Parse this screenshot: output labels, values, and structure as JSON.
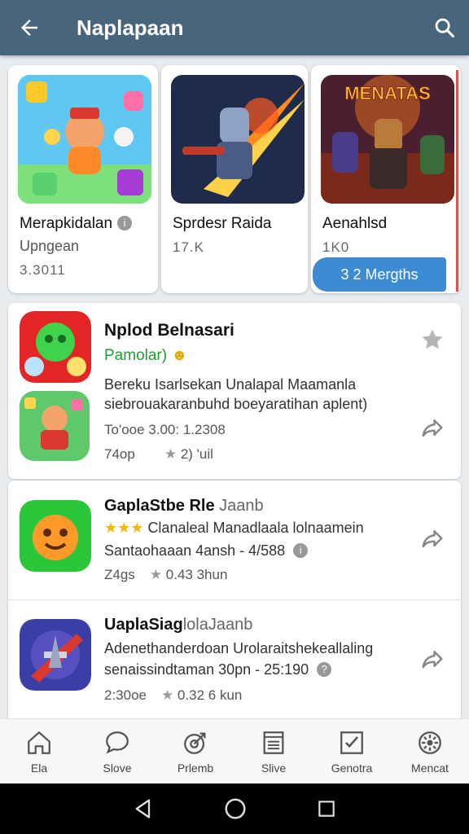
{
  "appbar": {
    "title": "Naplapaan"
  },
  "featured": [
    {
      "name": "Merapkidalan",
      "sub": "Upngean",
      "meta": "3.3011"
    },
    {
      "name": "Sprdesr Raida",
      "meta": "17.K"
    },
    {
      "name": "Aenahlsd",
      "meta": "1K0",
      "art_text": "MENATAS",
      "button": "3 2 Mergths"
    }
  ],
  "list": [
    {
      "title": "Nplod Belnasari",
      "tag": "Pamolar)",
      "desc1": "Bereku Isarlsekan Unalapal Maamanla",
      "desc2": "siebrouakaranbuhd boeyaratihan aplent)",
      "stats": "To'ooe 3.00: 1.2308",
      "size": "74op",
      "rating": "2) 'uil"
    },
    {
      "title": "GaplaStbe Rle",
      "title_light": "Jaanb",
      "desc1": "Clanaleal Manadlaala lolnaamein",
      "desc2": "Santaohaaan 4ansh - 4/588",
      "size": "Z4gs",
      "rating": "0.43 3hun"
    },
    {
      "title": "UaplaSiag",
      "title_light": "lolaJaanb",
      "desc1": "Adenethanderdoan Urolaraitshekeallaling",
      "desc2": "senaissindtaman 30pn - 25:190",
      "size": "2:30oe",
      "rating": "0.32 6 kun"
    }
  ],
  "bottom_nav": [
    {
      "label": "Ela",
      "icon": "home-icon"
    },
    {
      "label": "Slove",
      "icon": "chat-icon"
    },
    {
      "label": "Prlemb",
      "icon": "target-icon"
    },
    {
      "label": "Slive",
      "icon": "list-icon"
    },
    {
      "label": "Genotra",
      "icon": "checkbox-icon"
    },
    {
      "label": "Mencat",
      "icon": "gear-icon"
    }
  ]
}
